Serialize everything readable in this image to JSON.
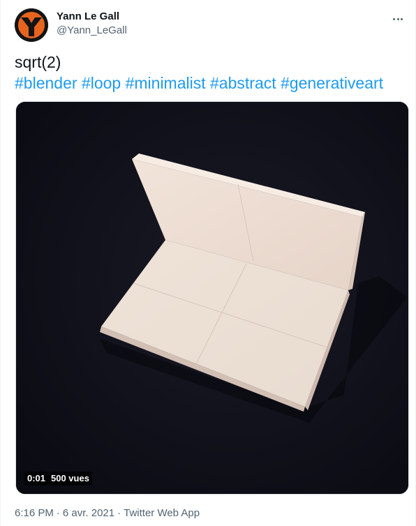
{
  "author": {
    "display_name": "Yann Le Gall",
    "handle": "@Yann_LeGall",
    "avatar_icon": "logo-avatar-icon"
  },
  "more_icon": "more-horizontal-icon",
  "tweet": {
    "text": "sqrt(2)",
    "hashtags": [
      "#blender",
      "#loop",
      "#minimalist",
      "#abstract",
      "#generativeart"
    ]
  },
  "media": {
    "type": "video",
    "elapsed": "0:01",
    "views": "500 vues"
  },
  "meta": {
    "time": "6:16 PM",
    "separator1": "·",
    "date": "6 avr. 2021",
    "separator2": "·",
    "source": "Twitter Web App"
  },
  "colors": {
    "link": "#1d9bf0",
    "secondary_text": "#536471",
    "avatar_orange": "#e8641e",
    "video_bg": "#0e0e17",
    "board": "#ecdcd2"
  }
}
